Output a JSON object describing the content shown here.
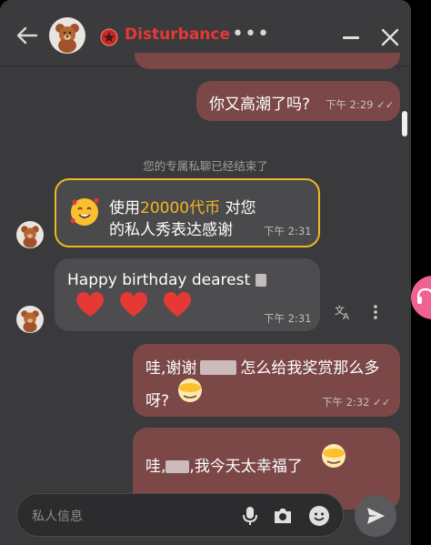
{
  "header": {
    "title": "Disturbance",
    "more_label": "•••"
  },
  "messages": {
    "m1_text": "你又高潮了吗?",
    "m1_time": "下午 2:29",
    "system_text": "您的专属私聊已经结束了",
    "gift_line1_a": "使用",
    "gift_line1_amount": "20000代币",
    "gift_line1_b": " 对您",
    "gift_line2": "的私人秀表达感谢",
    "gift_time": "下午 2:31",
    "m2_text": "Happy birthday dearest ",
    "m2_time": "下午 2:31",
    "m3_line1_a": "哇,谢谢",
    "m3_line1_b": "怎么给我奖赏那么多",
    "m3_line2": "呀?",
    "m3_time": "下午 2:32",
    "m4_text_a": "哇,",
    "m4_text_b": ",我今天太幸福了"
  },
  "input": {
    "placeholder": "私人信息"
  },
  "colors": {
    "accent_red": "#e53935",
    "gift_gold": "#f2b720",
    "outgoing_bubble": "#7b4747",
    "incoming_bubble": "#4d4d50"
  },
  "icons": {
    "back": "arrow-left-icon",
    "dnd": "do-not-disturb-icon",
    "minimize": "minimize-icon",
    "close": "close-icon",
    "translate": "translate-icon",
    "menu": "kebab-menu-icon",
    "mic": "microphone-icon",
    "camera": "camera-icon",
    "emoji": "emoji-icon",
    "send": "send-icon"
  }
}
